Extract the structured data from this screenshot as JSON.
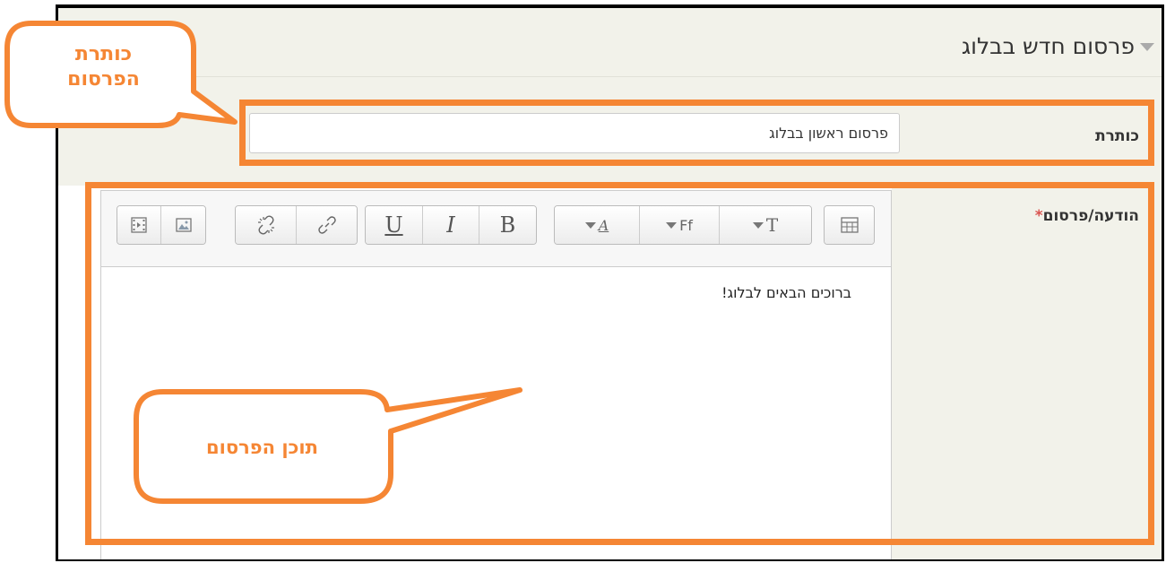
{
  "section": {
    "title": "פרסום חדש בבלוג"
  },
  "form": {
    "title_label": "כותרת",
    "title_value": "פרסום ראשון בבלוג",
    "message_label": "הודעה/פרסום",
    "required_mark": "*"
  },
  "toolbar": {
    "groups": [
      [
        "show-more-buttons-icon"
      ],
      [
        "text-size-icon",
        "font-family-icon",
        "font-color-icon"
      ],
      [
        "bold-icon",
        "italic-icon",
        "underline-icon"
      ],
      [
        "link-icon",
        "unlink-icon"
      ],
      [
        "image-icon",
        "media-icon"
      ]
    ],
    "bold_label": "B",
    "italic_label": "I",
    "underline_label": "U",
    "text_size_label": "T",
    "font_family_label": "Ff",
    "font_color_label": "A"
  },
  "editor": {
    "content": "ברוכים הבאים לבלוג!"
  },
  "annotations": {
    "title_callout": {
      "line1": "כותרת",
      "line2": "הפרסום"
    },
    "content_callout": "תוכן הפרסום",
    "color": "#f58634"
  },
  "colors": {
    "panel_bg": "#f2f2ea",
    "accent": "#f58634",
    "required": "#d9534f"
  }
}
